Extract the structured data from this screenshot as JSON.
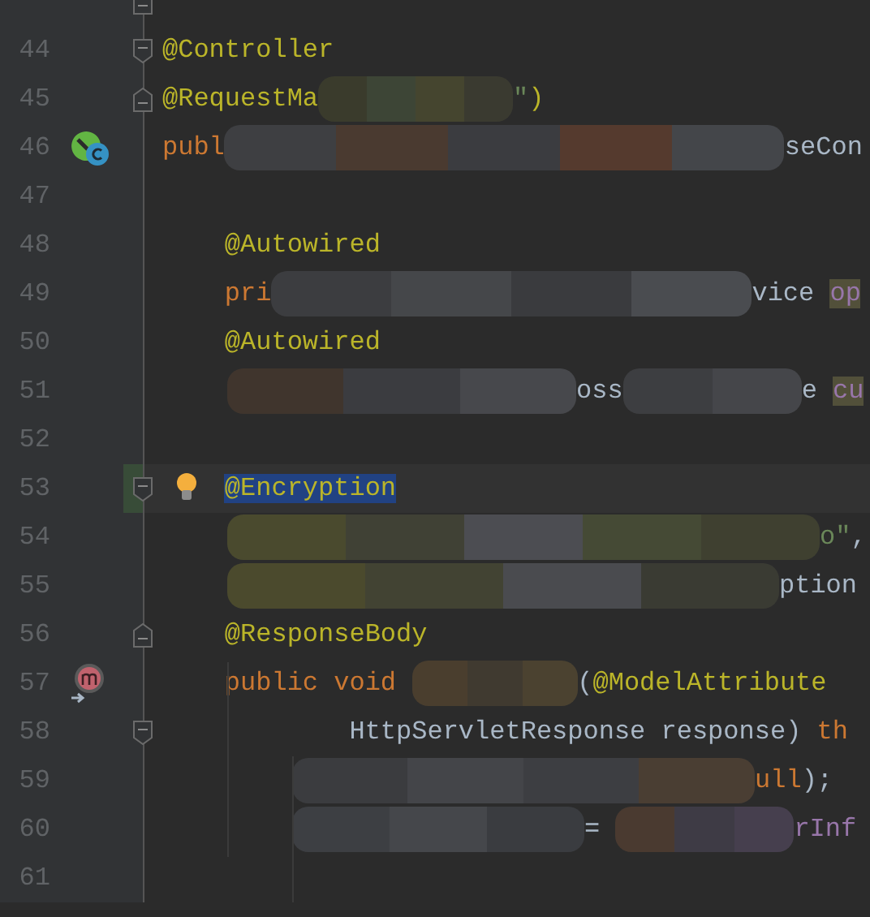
{
  "editor": {
    "lines": [
      {
        "fold": {
          "kind": "end"
        }
      },
      {
        "number": "44",
        "fold": {
          "kind": "start"
        },
        "segments": [
          {
            "kind": "annotation",
            "text": "@Controller"
          }
        ]
      },
      {
        "number": "45",
        "fold": {
          "kind": "end"
        },
        "segments": [
          {
            "kind": "annotation",
            "text": "@RequestMa"
          },
          {
            "kind": "redacted"
          },
          {
            "kind": "string",
            "text": "\""
          },
          {
            "kind": "annotation",
            "text": ")"
          }
        ]
      },
      {
        "number": "46",
        "gutter_icon": {
          "kind": "class"
        },
        "segments": [
          {
            "kind": "keyword",
            "text": "publ"
          },
          {
            "kind": "redacted"
          },
          {
            "kind": "plain",
            "text": "seCon"
          }
        ]
      },
      {
        "number": "47"
      },
      {
        "number": "48",
        "segments": [
          {
            "kind": "annotation",
            "text": "    @Autowired"
          }
        ]
      },
      {
        "number": "49",
        "segments": [
          {
            "kind": "keyword",
            "text": "    pri"
          },
          {
            "kind": "redacted"
          },
          {
            "kind": "plain",
            "text": "vice "
          },
          {
            "kind": "field",
            "text": "op",
            "highlighted": true
          }
        ]
      },
      {
        "number": "50",
        "segments": [
          {
            "kind": "annotation",
            "text": "    @Autowired"
          }
        ]
      },
      {
        "number": "51",
        "segments": [
          {
            "kind": "redacted"
          },
          {
            "kind": "plain",
            "text": "oss"
          },
          {
            "kind": "redacted"
          },
          {
            "kind": "plain",
            "text": "e "
          },
          {
            "kind": "field",
            "text": "cu",
            "highlighted": true
          }
        ]
      },
      {
        "number": "52"
      },
      {
        "number": "53",
        "fold": {
          "kind": "start"
        },
        "current": true,
        "changed": true,
        "gutter_icon": {
          "kind": "bulb"
        },
        "segments": [
          {
            "kind": "annotation",
            "text": "    @Encryption",
            "selected": true
          }
        ]
      },
      {
        "number": "54",
        "segments": [
          {
            "kind": "redacted"
          },
          {
            "kind": "string",
            "text": "o\""
          },
          {
            "kind": "plain",
            "text": ","
          }
        ]
      },
      {
        "number": "55",
        "segments": [
          {
            "kind": "redacted"
          },
          {
            "kind": "plain",
            "text": "ption"
          }
        ]
      },
      {
        "number": "56",
        "fold": {
          "kind": "end"
        },
        "segments": [
          {
            "kind": "annotation",
            "text": "    @ResponseBody"
          }
        ]
      },
      {
        "number": "57",
        "gutter_icon": {
          "kind": "method"
        },
        "segments": [
          {
            "kind": "keyword",
            "text": "    public void "
          },
          {
            "kind": "redacted"
          },
          {
            "kind": "plain",
            "text": "("
          },
          {
            "kind": "annotation",
            "text": "@ModelAttribute"
          }
        ]
      },
      {
        "number": "58",
        "fold": {
          "kind": "start"
        },
        "segments": [
          {
            "kind": "plain",
            "text": "            HttpServletResponse response) "
          },
          {
            "kind": "keyword",
            "text": "th"
          }
        ]
      },
      {
        "number": "59",
        "segments": [
          {
            "kind": "redacted"
          },
          {
            "kind": "keyword",
            "text": "ull"
          },
          {
            "kind": "plain",
            "text": ");"
          }
        ]
      },
      {
        "number": "60",
        "segments": [
          {
            "kind": "redacted"
          },
          {
            "kind": "plain",
            "text": "= "
          },
          {
            "kind": "redacted"
          },
          {
            "kind": "field",
            "text": "rInf",
            "highlighted": false
          }
        ]
      },
      {
        "number": "61"
      }
    ]
  }
}
